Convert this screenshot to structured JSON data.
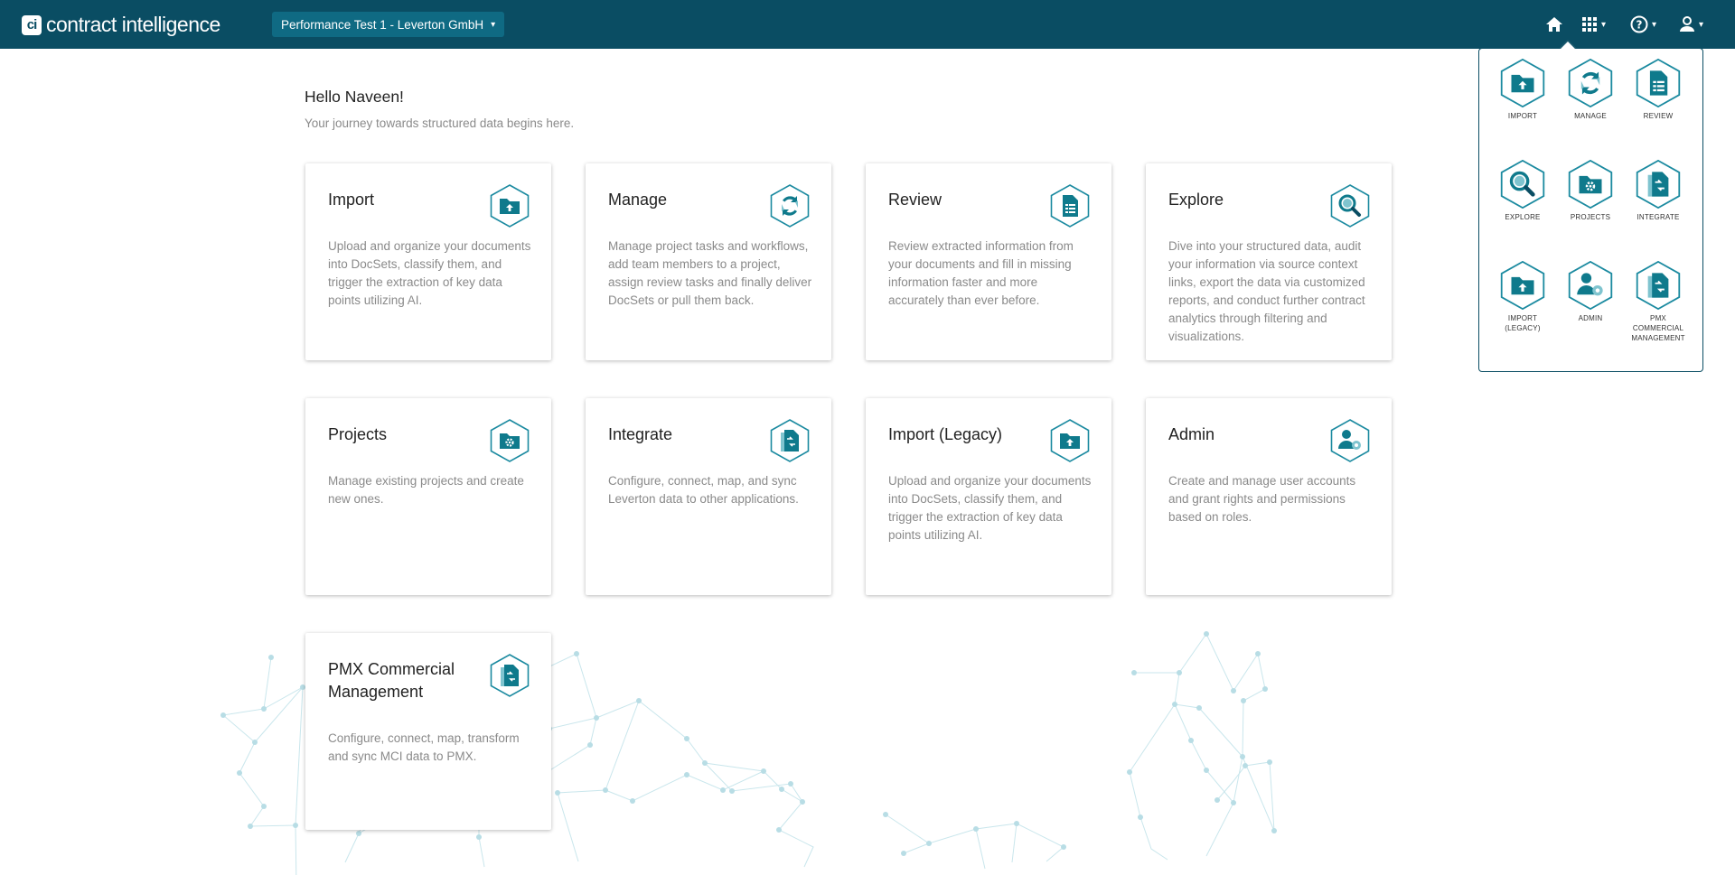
{
  "header": {
    "logo_mark": "ci",
    "logo_text": "contract intelligence",
    "project_selector": "Performance Test 1 - Leverton GmbH",
    "icons": [
      "home-icon",
      "apps-grid-icon",
      "help-icon",
      "user-icon"
    ]
  },
  "greeting": {
    "title": "Hello Naveen!",
    "subtitle": "Your journey towards structured data begins here."
  },
  "cards": [
    {
      "title": "Import",
      "icon": "import-icon",
      "description": "Upload and organize your documents into DocSets, classify them, and trigger the extraction of key data points utilizing AI."
    },
    {
      "title": "Manage",
      "icon": "manage-icon",
      "description": "Manage project tasks and workflows, add team members to a project, assign review tasks and finally deliver DocSets or pull them back."
    },
    {
      "title": "Review",
      "icon": "review-icon",
      "description": "Review extracted information from your documents and fill in missing information faster and more accurately than ever before."
    },
    {
      "title": "Explore",
      "icon": "explore-icon",
      "description": "Dive into your structured data, audit your information via source context links, export the data via customized reports, and conduct further contract analytics through filtering and visualizations."
    },
    {
      "title": "Projects",
      "icon": "projects-icon",
      "description": "Manage existing projects and create new ones."
    },
    {
      "title": "Integrate",
      "icon": "integrate-icon",
      "description": "Configure, connect, map, and sync Leverton data to other applications."
    },
    {
      "title": "Import (Legacy)",
      "icon": "import-legacy-icon",
      "description": "Upload and organize your documents into DocSets, classify them, and trigger the extraction of key data points utilizing AI."
    },
    {
      "title": "Admin",
      "icon": "admin-icon",
      "description": "Create and manage user accounts and grant rights and permissions based on roles."
    },
    {
      "title": "PMX Commercial Management",
      "icon": "pmx-icon",
      "description": "Configure, connect, map, transform and sync MCI data to PMX."
    }
  ],
  "apps_menu": [
    {
      "label": "IMPORT",
      "icon": "import-icon"
    },
    {
      "label": "MANAGE",
      "icon": "manage-icon"
    },
    {
      "label": "REVIEW",
      "icon": "review-icon"
    },
    {
      "label": "EXPLORE",
      "icon": "explore-icon"
    },
    {
      "label": "PROJECTS",
      "icon": "projects-icon"
    },
    {
      "label": "INTEGRATE",
      "icon": "integrate-icon"
    },
    {
      "label": "IMPORT (LEGACY)",
      "icon": "import-legacy-icon"
    },
    {
      "label": "ADMIN",
      "icon": "admin-icon"
    },
    {
      "label": "PMX COMMERCIAL MANAGEMENT",
      "icon": "pmx-icon"
    }
  ],
  "colors": {
    "header_bg": "#0a4d63",
    "accent": "#0f7a8c",
    "hex_border": "#1b8aa0"
  }
}
